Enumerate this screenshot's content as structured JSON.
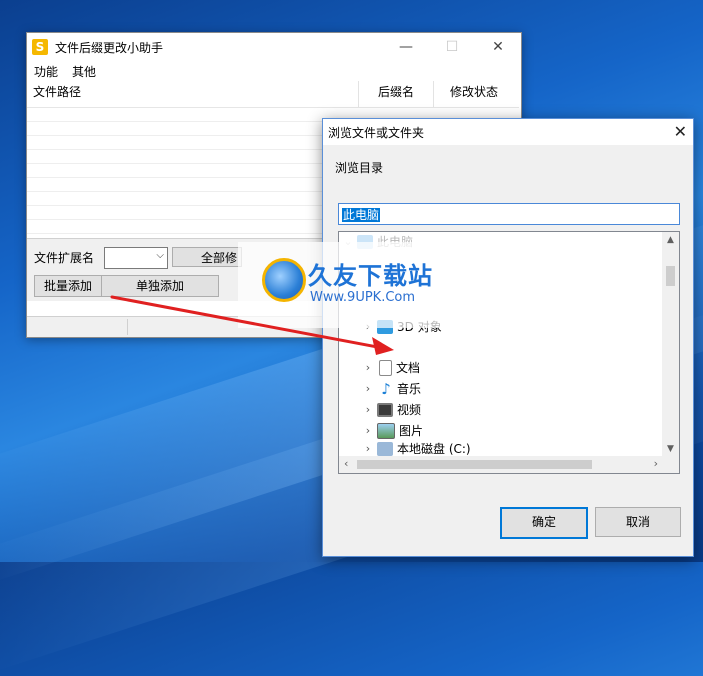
{
  "main_window": {
    "title": "文件后缀更改小助手",
    "app_icon_letter": "S",
    "controls": {
      "minimize": "—",
      "maximize": "☐",
      "close": "✕"
    },
    "menu": [
      "功能",
      "其他"
    ],
    "columns": {
      "path": "文件路径",
      "extension": "后缀名",
      "status": "修改状态"
    },
    "ext_label": "文件扩展名",
    "combo_value": "",
    "buttons": {
      "modify_all": "全部修",
      "batch_add": "批量添加",
      "single_add": "单独添加"
    }
  },
  "dialog": {
    "title": "浏览文件或文件夹",
    "description": "浏览目录",
    "folder_name": "此电脑",
    "tree": [
      {
        "label": "此电脑",
        "icon": "computer-icon",
        "dim": true
      },
      {
        "label": "3D 对象",
        "icon": "3d-objects-icon",
        "dim": false
      },
      {
        "label": "文档",
        "icon": "document-icon",
        "dim": false
      },
      {
        "label": "音乐",
        "icon": "music-icon",
        "dim": false
      },
      {
        "label": "视频",
        "icon": "video-icon",
        "dim": false
      },
      {
        "label": "图片",
        "icon": "picture-icon",
        "dim": false
      },
      {
        "label": "本地磁盘 (C:)",
        "icon": "drive-icon",
        "dim": false
      }
    ],
    "ok_label": "确定",
    "cancel_label": "取消"
  },
  "watermark": {
    "name": "久友下载站",
    "url": "Www.9UPK.Com"
  },
  "colors": {
    "accent": "#0078d7",
    "arrow": "#e02020",
    "app_icon": "#f5b800"
  }
}
